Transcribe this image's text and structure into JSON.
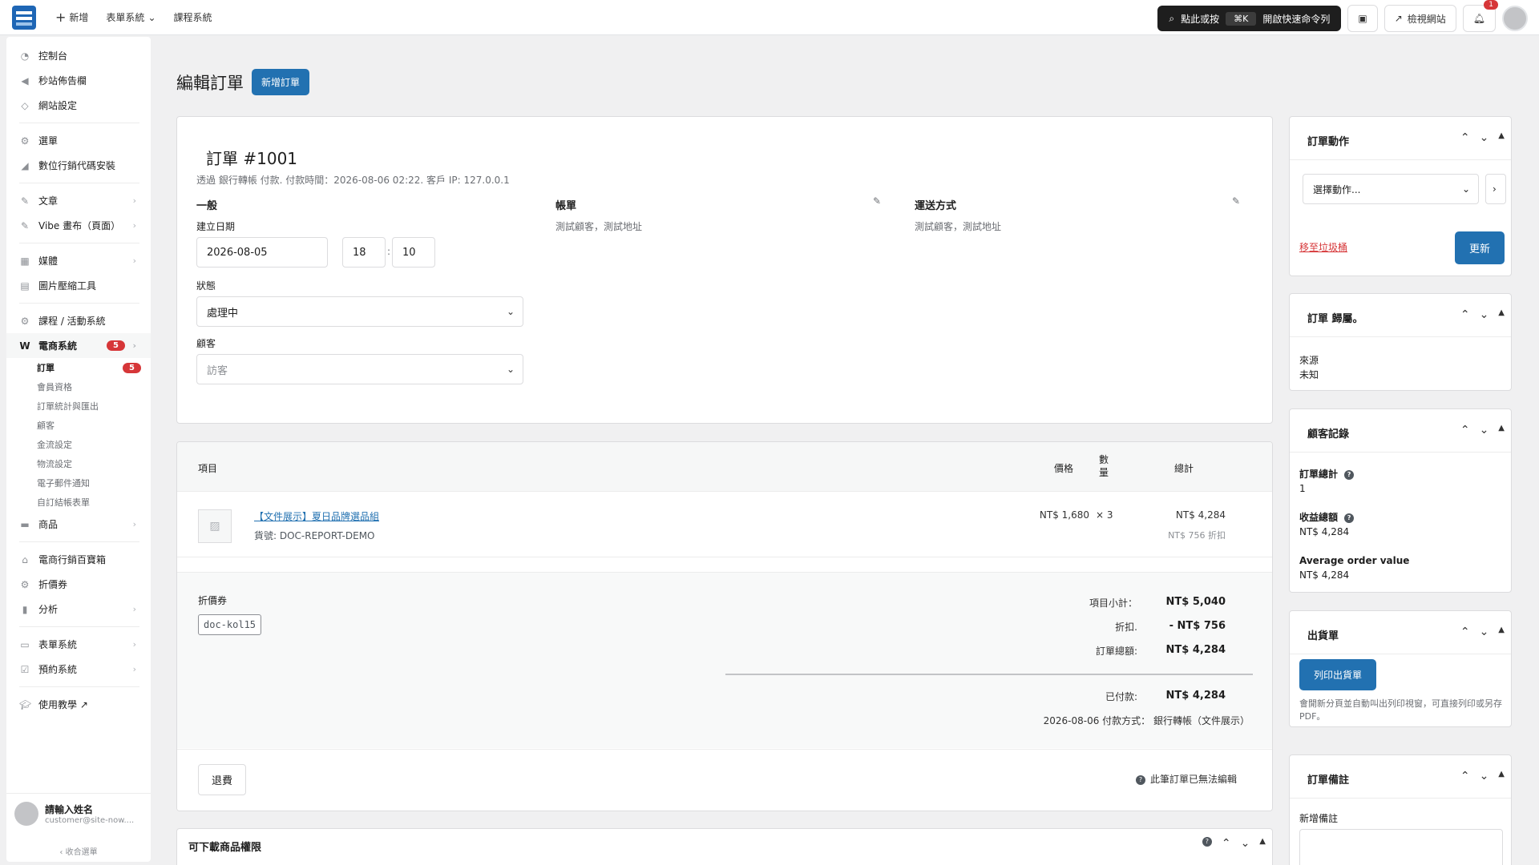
{
  "topbar": {
    "new_label": "新增",
    "forms_label": "表單系統",
    "course_label": "課程系統",
    "command_label": "點此或按",
    "command_kbd": "⌘K",
    "command_hint": "開啟快速命令列",
    "view_site": "檢視網站",
    "notif_count": "1"
  },
  "sidebar": {
    "items": [
      {
        "label": "控制台",
        "icon": "dashboard-icon"
      },
      {
        "label": "秒站佈告欄",
        "icon": "megaphone-icon"
      },
      {
        "label": "網站設定",
        "icon": "diamond-icon"
      },
      {
        "label": "選單",
        "icon": "gear-icon"
      },
      {
        "label": "數位行銷代碼安裝",
        "icon": "chart-icon"
      },
      {
        "label": "文章",
        "icon": "pin-icon"
      },
      {
        "label": "Vibe 畫布（頁面）",
        "icon": "pin-icon"
      },
      {
        "label": "媒體",
        "icon": "media-icon"
      },
      {
        "label": "圖片壓縮工具",
        "icon": "image-icon"
      },
      {
        "label": "課程 / 活動系統",
        "icon": "gear-icon"
      },
      {
        "label": "電商系統",
        "icon": "woo-icon",
        "badge": "5"
      },
      {
        "label": "商品",
        "icon": "box-icon"
      },
      {
        "label": "電商行銷百寶箱",
        "icon": "store-icon"
      },
      {
        "label": "折價券",
        "icon": "gear-icon"
      },
      {
        "label": "分析",
        "icon": "bar-chart-icon"
      },
      {
        "label": "表單系統",
        "icon": "form-icon"
      },
      {
        "label": "預約系統",
        "icon": "check-icon"
      },
      {
        "label": "使用教學 ↗",
        "icon": "graduation-icon"
      }
    ],
    "sub_items": [
      {
        "label": "訂單",
        "badge": "5"
      },
      {
        "label": "會員資格"
      },
      {
        "label": "訂單統計與匯出"
      },
      {
        "label": "顧客"
      },
      {
        "label": "金流設定"
      },
      {
        "label": "物流設定"
      },
      {
        "label": "電子郵件通知"
      },
      {
        "label": "自訂結帳表單"
      }
    ],
    "user_name": "請輸入姓名",
    "user_email": "customer@site-now....",
    "collapse": "收合選單"
  },
  "page": {
    "title": "編輯訂單",
    "add_button": "新增訂單"
  },
  "order": {
    "title": "訂單 #1001",
    "meta": "透過 銀行轉帳 付款. 付款時間：2026-08-06 02:22. 客戶 IP: 127.0.0.1",
    "general_h": "一般",
    "created_label": "建立日期",
    "created_date": "2026-08-05",
    "hour": "18",
    "minute": "10",
    "status_label": "狀態",
    "status_value": "處理中",
    "customer_label": "顧客",
    "customer_value": "訪客",
    "billing_h": "帳單",
    "billing_text": "測試顧客，測試地址",
    "shipping_h": "運送方式",
    "shipping_text": "測試顧客，測試地址"
  },
  "items": {
    "col_item": "項目",
    "col_price": "價格",
    "col_qty": "數量",
    "col_total": "總計",
    "rows": [
      {
        "name": "【文件展示】夏日品牌選品組",
        "sku": "貨號: DOC-REPORT-DEMO",
        "price": "NT$ 1,680",
        "qty": "× 3",
        "total": "NT$ 4,284",
        "discount": "NT$ 756 折扣"
      }
    ],
    "coupon_label": "折價券",
    "coupon_code": "doc-kol15",
    "subtotal_label": "項目小計：",
    "subtotal_value": "NT$ 5,040",
    "discount_label": "折扣.",
    "discount_value": "- NT$ 756",
    "order_total_label": "訂單總額:",
    "order_total_value": "NT$ 4,284",
    "paid_label": "已付款:",
    "paid_value": "NT$ 4,284",
    "paid_note": "2026-08-06 付款方式： 銀行轉帳（文件展示）",
    "refund_button": "退費",
    "not_editable": "此筆訂單已無法編輯"
  },
  "downloads": {
    "title": "可下載商品權限"
  },
  "side": {
    "actions_title": "訂單動作",
    "actions_select": "選擇動作...",
    "trash_link": "移至垃圾桶",
    "update_button": "更新",
    "attribution_title": "訂單 歸屬。",
    "source_label": "來源",
    "source_value": "未知",
    "history_title": "顧客記錄",
    "total_orders_label": "訂單總計",
    "total_orders_value": "1",
    "revenue_label": "收益總額",
    "revenue_value": "NT$ 4,284",
    "aov_label": "Average order value",
    "aov_value": "NT$ 4,284",
    "packing_title": "出貨單",
    "print_button": "列印出貨單",
    "print_note": "會開新分頁並自動叫出列印視窗，可直接列印或另存 PDF。",
    "notes_title": "訂單備註",
    "add_note_label": "新增備註"
  },
  "colors": {
    "primary": "#2271b1",
    "danger": "#d63638"
  }
}
